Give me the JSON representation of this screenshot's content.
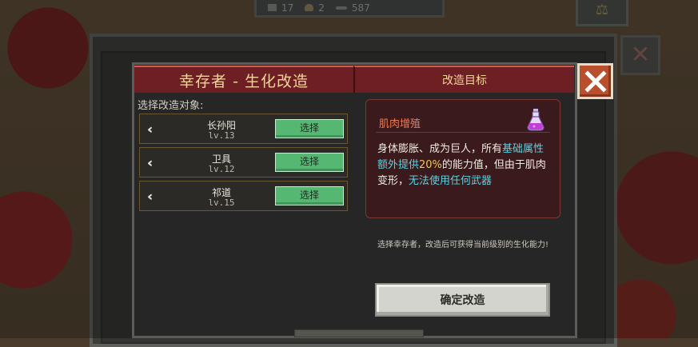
{
  "top_stats": {
    "items": [
      {
        "icon": "calendar-icon",
        "value": "17"
      },
      {
        "icon": "bread-icon",
        "value": "2"
      },
      {
        "icon": "bone-icon",
        "value": "587"
      }
    ]
  },
  "dialog": {
    "title": "幸存者 - 生化改造",
    "target_header": "改造目标",
    "select_label": "选择改造对象:",
    "survivors": [
      {
        "name": "长孙阳",
        "level": "lv.13",
        "button": "选择"
      },
      {
        "name": "卫具",
        "level": "lv.12",
        "button": "选择"
      },
      {
        "name": "祁道",
        "level": "lv.15",
        "button": "选择"
      }
    ],
    "effect": {
      "name": "肌肉增殖",
      "icon": "potion-icon",
      "desc_1": "身体膨胀、成为巨人，所有",
      "desc_2": "基础属性额外提供",
      "desc_3": "20%",
      "desc_4": "的能力值，但由于肌肉变形，",
      "desc_5": "无法使用任何武器"
    },
    "hint": "选择幸存者，改造后可获得当前级别的生化能力!",
    "confirm_button": "确定改造"
  },
  "colors": {
    "title_bar": "#6e1f24",
    "select_button": "#55b772",
    "highlight_cyan": "#59d3e0",
    "highlight_yellow": "#efc757",
    "close_button": "#b8502d"
  }
}
